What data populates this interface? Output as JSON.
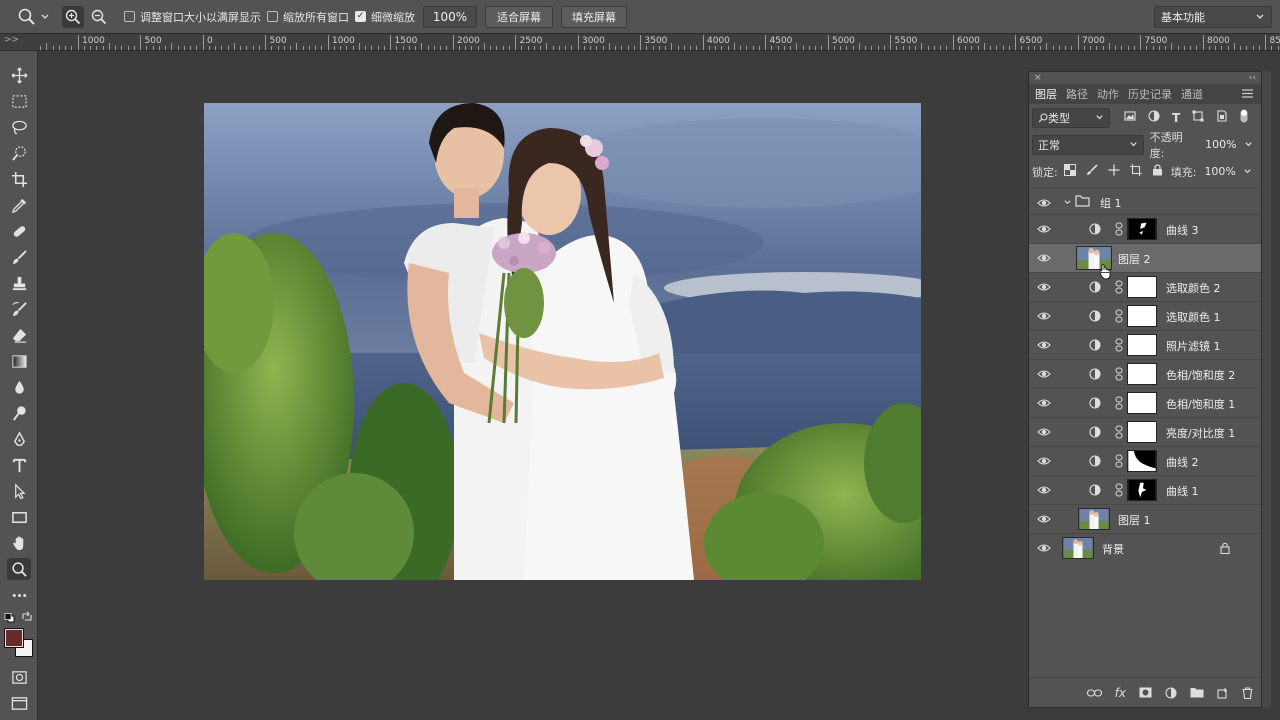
{
  "options_bar": {
    "resize_windows_label": "调整窗口大小以满屏显示",
    "resize_windows_checked": false,
    "zoom_all_label": "缩放所有窗口",
    "zoom_all_checked": false,
    "scrubby_zoom_label": "细微缩放",
    "scrubby_zoom_checked": true,
    "zoom_value": "100%",
    "fit_screen_label": "适合屏幕",
    "fill_screen_label": "填充屏幕",
    "workspace_label": "基本功能"
  },
  "ruler": {
    "corner_label": ">>",
    "labels": [
      "1000",
      "500",
      "0",
      "500",
      "1000",
      "1500",
      "2000",
      "2500",
      "3000",
      "3500",
      "4000",
      "4500",
      "5000",
      "5500",
      "6000",
      "6500",
      "7000",
      "7500",
      "8000",
      "85"
    ]
  },
  "panel": {
    "close_label": "×",
    "collapse_label": "‹‹",
    "tabs": [
      "图层",
      "路径",
      "动作",
      "历史记录",
      "通道"
    ],
    "active_tab": 0,
    "filter_kind": "类型",
    "blend_mode": "正常",
    "opacity_label": "不透明度:",
    "opacity_value": "100%",
    "lock_label": "锁定:",
    "fill_label": "填充:",
    "fill_value": "100%",
    "layers": [
      {
        "name": "组 1",
        "kind": "group"
      },
      {
        "name": "曲线 3",
        "kind": "adjustment",
        "mask": "curve3"
      },
      {
        "name": "图层 2",
        "kind": "image",
        "selected": true
      },
      {
        "name": "选取颜色 2",
        "kind": "adjustment",
        "mask": "white"
      },
      {
        "name": "选取颜色 1",
        "kind": "adjustment",
        "mask": "white"
      },
      {
        "name": "照片滤镜 1",
        "kind": "adjustment",
        "mask": "white"
      },
      {
        "name": "色相/饱和度 2",
        "kind": "adjustment",
        "mask": "white"
      },
      {
        "name": "色相/饱和度 1",
        "kind": "adjustment",
        "mask": "white"
      },
      {
        "name": "亮度/对比度 1",
        "kind": "adjustment",
        "mask": "white"
      },
      {
        "name": "曲线 2",
        "kind": "adjustment",
        "mask": "curve2"
      },
      {
        "name": "曲线 1",
        "kind": "adjustment",
        "mask": "curve1"
      },
      {
        "name": "图层 1",
        "kind": "image"
      },
      {
        "name": "背景",
        "kind": "background",
        "locked": true
      }
    ]
  },
  "colors": {
    "foreground": "#6b2a2a",
    "background": "#f2f2f2",
    "panel_bg": "#535353",
    "selected_layer": "#6a6a6a"
  }
}
